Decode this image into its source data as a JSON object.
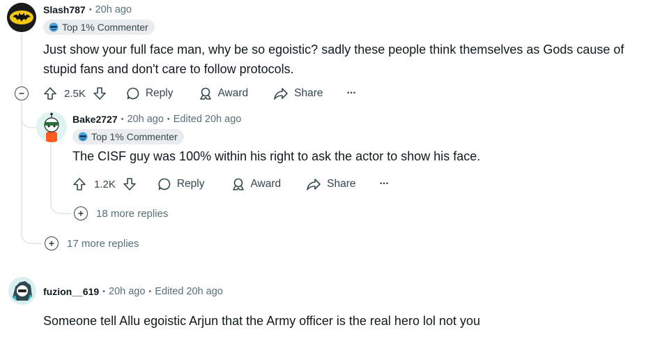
{
  "comments": [
    {
      "username": "Slash787",
      "time": "20h ago",
      "edited": "",
      "flair": "Top 1% Commenter",
      "text": "Just show your full face man, why be so egoistic? sadly these people think themselves as Gods cause of stupid fans and don't care to follow protocols.",
      "score": "2.5K",
      "more_replies": "17 more replies"
    },
    {
      "username": "Bake2727",
      "time": "20h ago",
      "edited": "Edited 20h ago",
      "flair": "Top 1% Commenter",
      "text": "The CISF guy was 100% within his right to ask the actor to show his face.",
      "score": "1.2K",
      "more_replies": "18 more replies"
    },
    {
      "username": "fuzion__619",
      "time": "20h ago",
      "edited": "Edited 20h ago",
      "text": "Someone tell Allu egoistic Arjun that the Army officer is the real hero lol not you"
    }
  ],
  "actions": {
    "reply": "Reply",
    "award": "Award",
    "share": "Share",
    "more": "···"
  },
  "separator": "•",
  "colors": {
    "thread_line": "#e5ebee",
    "meta_text": "#576f76",
    "flair_bg": "#eaedef"
  },
  "icons": [
    "upvote-icon",
    "downvote-icon",
    "comment-bubble-icon",
    "award-icon",
    "share-arrow-icon",
    "overflow-dots-icon",
    "plus-circle-icon",
    "minus-circle-icon"
  ]
}
